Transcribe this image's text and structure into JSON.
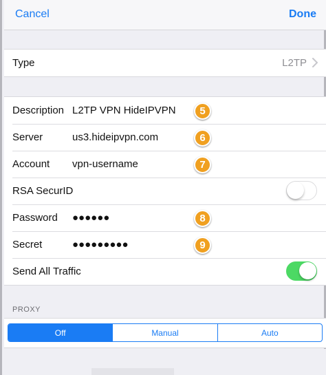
{
  "navbar": {
    "cancel_label": "Cancel",
    "done_label": "Done"
  },
  "type_row": {
    "label": "Type",
    "value": "L2TP",
    "chevron": "chevron-right-icon"
  },
  "fields": {
    "description": {
      "label": "Description",
      "value": "L2TP VPN HideIPVPN",
      "badge": "5"
    },
    "server": {
      "label": "Server",
      "value": "us3.hideipvpn.com",
      "badge": "6"
    },
    "account": {
      "label": "Account",
      "value": "vpn-username",
      "badge": "7"
    },
    "rsa": {
      "label": "RSA SecurID",
      "toggle": "off"
    },
    "password": {
      "label": "Password",
      "value": "●●●●●●",
      "badge": "8"
    },
    "secret": {
      "label": "Secret",
      "value": "●●●●●●●●●",
      "badge": "9"
    },
    "send_all": {
      "label": "Send All Traffic",
      "toggle": "on"
    }
  },
  "proxy": {
    "header": "PROXY",
    "options": [
      "Off",
      "Manual",
      "Auto"
    ],
    "selected": "Off"
  },
  "colors": {
    "accent": "#1a7cf4",
    "badge": "#f0a020",
    "toggle_on": "#4cd964",
    "background": "#efeff4"
  }
}
